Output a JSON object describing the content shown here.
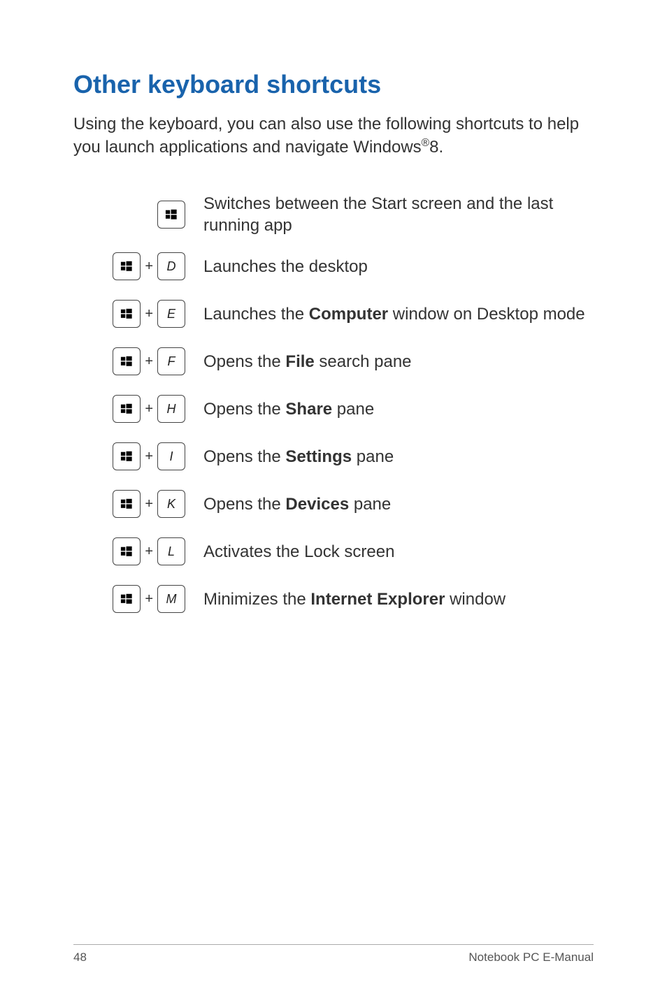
{
  "heading": "Other keyboard shortcuts",
  "intro_prefix": "Using the keyboard, you can also use the following shortcuts to help you launch applications and navigate Windows",
  "intro_reg": "®",
  "intro_suffix": "8.",
  "shortcuts": [
    {
      "key": "",
      "desc_parts": [
        {
          "t": "Switches between the Start screen and the last running app",
          "b": false
        }
      ]
    },
    {
      "key": "D",
      "desc_parts": [
        {
          "t": "Launches the desktop",
          "b": false
        }
      ]
    },
    {
      "key": "E",
      "desc_parts": [
        {
          "t": "Launches the ",
          "b": false
        },
        {
          "t": "Computer",
          "b": true
        },
        {
          "t": " window on Desktop mode",
          "b": false
        }
      ]
    },
    {
      "key": "F",
      "desc_parts": [
        {
          "t": "Opens the ",
          "b": false
        },
        {
          "t": "File",
          "b": true
        },
        {
          "t": " search pane",
          "b": false
        }
      ]
    },
    {
      "key": "H",
      "desc_parts": [
        {
          "t": "Opens the ",
          "b": false
        },
        {
          "t": "Share",
          "b": true
        },
        {
          "t": " pane",
          "b": false
        }
      ]
    },
    {
      "key": "I",
      "desc_parts": [
        {
          "t": "Opens the ",
          "b": false
        },
        {
          "t": "Settings",
          "b": true
        },
        {
          "t": " pane",
          "b": false
        }
      ]
    },
    {
      "key": "K",
      "desc_parts": [
        {
          "t": "Opens the ",
          "b": false
        },
        {
          "t": "Devices",
          "b": true
        },
        {
          "t": " pane",
          "b": false
        }
      ]
    },
    {
      "key": "L",
      "desc_parts": [
        {
          "t": "Activates the Lock screen",
          "b": false
        }
      ]
    },
    {
      "key": "M",
      "desc_parts": [
        {
          "t": "Minimizes the ",
          "b": false
        },
        {
          "t": "Internet Explorer",
          "b": true
        },
        {
          "t": " window",
          "b": false
        }
      ]
    }
  ],
  "footer": {
    "page": "48",
    "label": "Notebook PC E-Manual"
  }
}
